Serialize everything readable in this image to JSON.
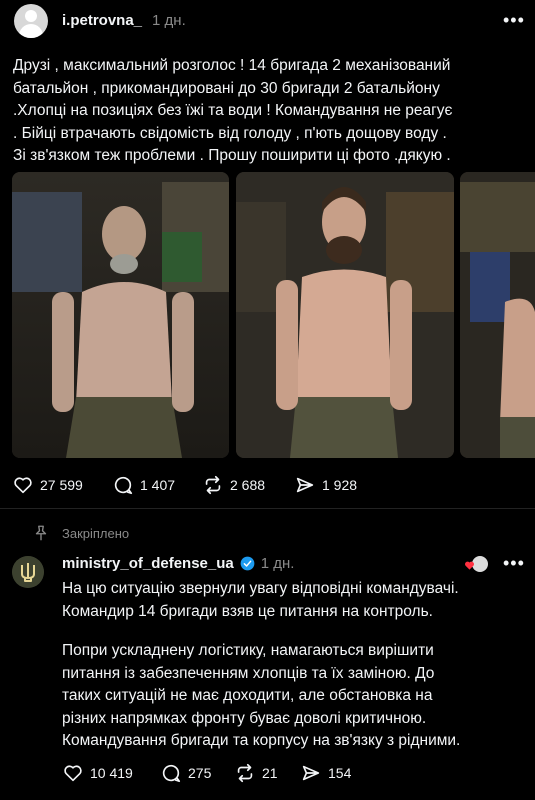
{
  "post": {
    "username": "i.petrovna_",
    "time": "1 дн.",
    "more": "•••",
    "text": [
      "Друзі , максимальний розголос ! 14 бригада 2 механізований",
      "батальйон , прикомандировані до 30 бригади 2 батальйону",
      ".Хлопці на позиціях без їжі та води ! Командування не реагує",
      ". Бійці втрачають свідомість від голоду , п'ють дощову воду .",
      "Зі зв'язком теж проблеми . Прошу поширити ці фото .дякую ."
    ],
    "stats": {
      "likes": "27 599",
      "comments": "1 407",
      "reposts": "2 688",
      "shares": "1 928"
    }
  },
  "pinned": {
    "label": "Закріплено"
  },
  "reply": {
    "username": "ministry_of_defense_ua",
    "time": "1 дн.",
    "more": "•••",
    "paragraphs": [
      [
        "На цю ситуацію звернули увагу відповідні командувачі.",
        "Командир 14 бригади взяв це питання на контроль."
      ],
      [
        "Попри ускладнену логістику, намагаються вирішити",
        "питання із забезпеченням хлопців та їх заміною. До",
        "таких ситуацій не має доходити, але обстановка на",
        "різних напрямках фронту буває доволі критичною."
      ],
      [
        "Командування бригади та корпусу на зв'язку з рідними."
      ]
    ],
    "stats": {
      "likes": "10 419",
      "comments": "275",
      "reposts": "21",
      "shares": "154"
    }
  }
}
